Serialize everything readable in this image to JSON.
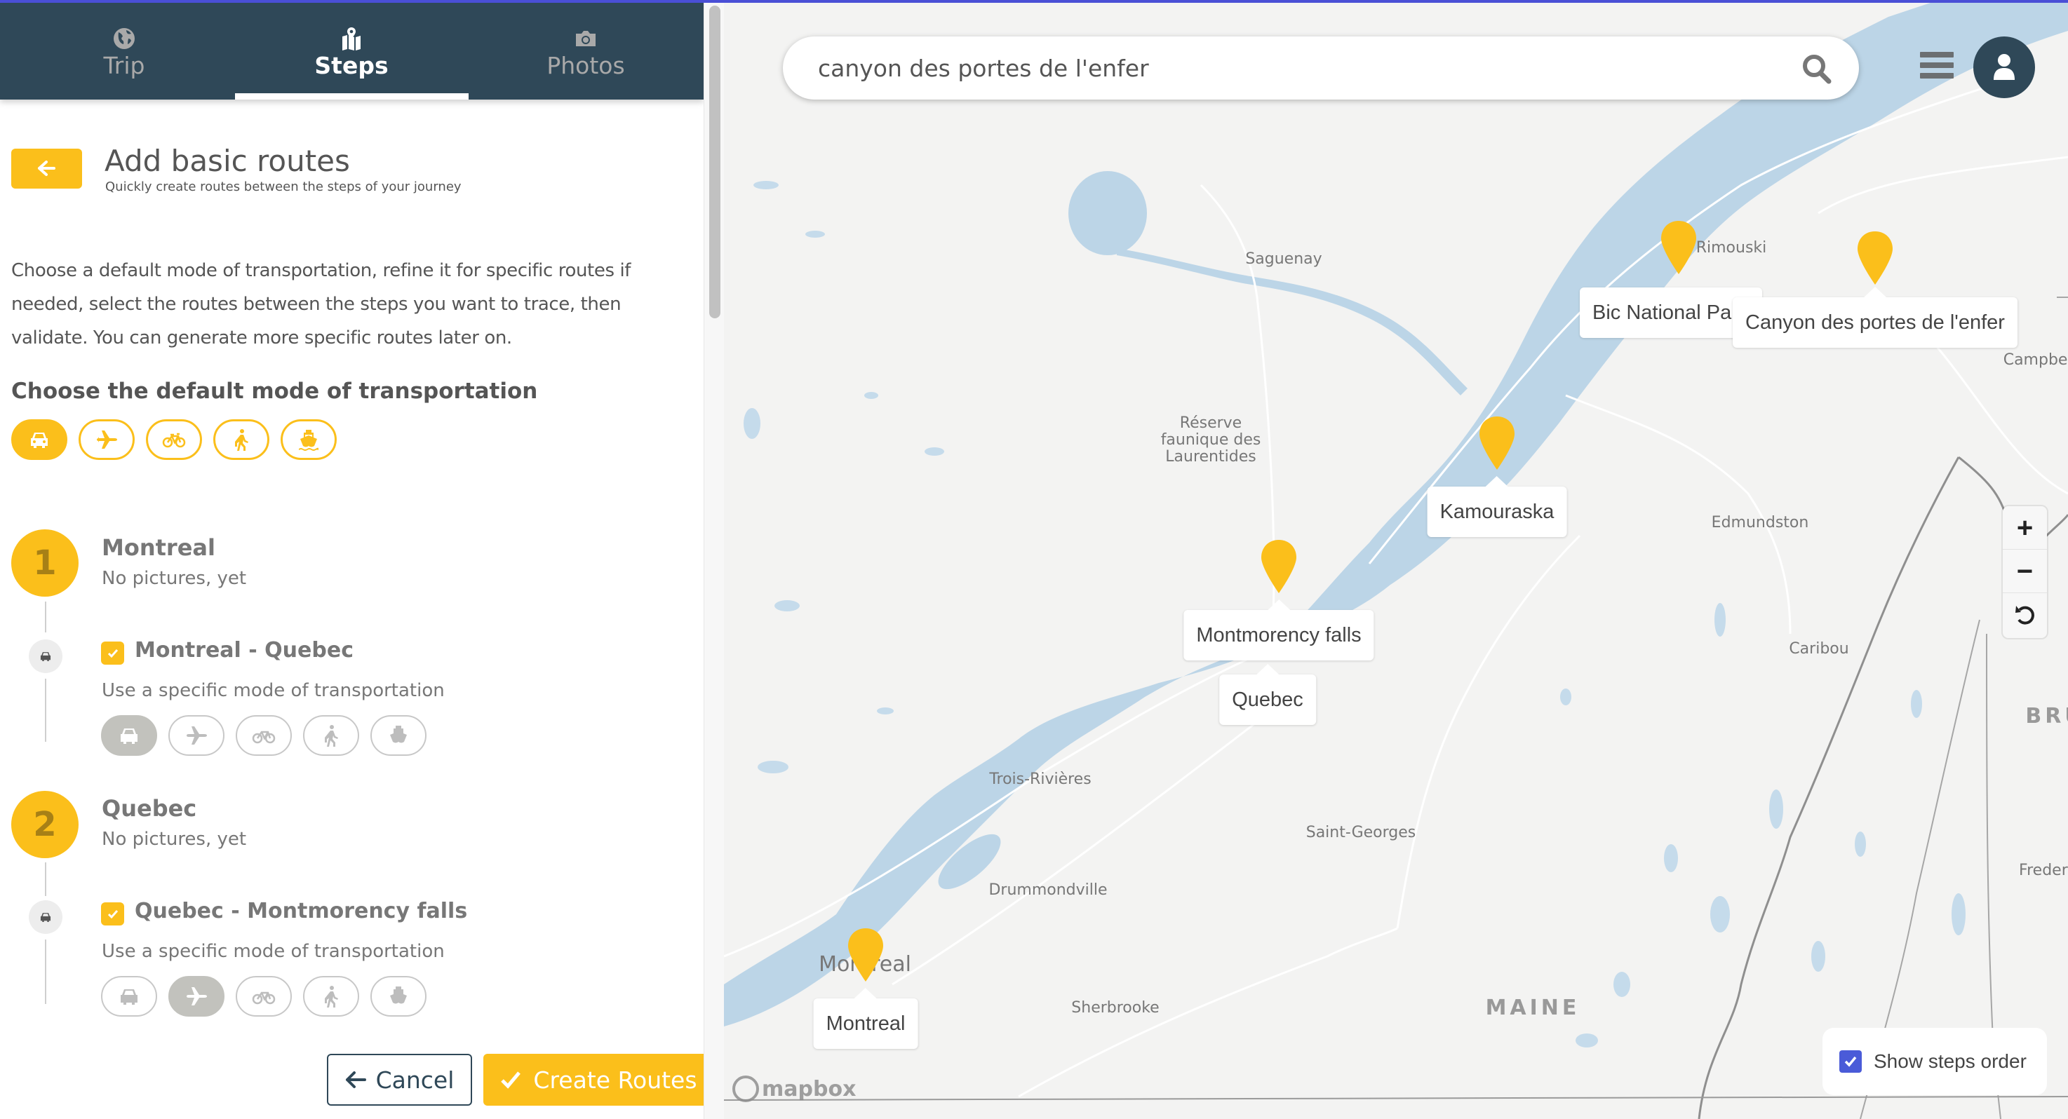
{
  "header": {
    "tabs": [
      {
        "label": "Trip",
        "icon": "globe-icon",
        "active": false
      },
      {
        "label": "Steps",
        "icon": "map-marker-icon",
        "active": true
      },
      {
        "label": "Photos",
        "icon": "camera-icon",
        "active": false
      }
    ]
  },
  "panel": {
    "back_icon": "arrow-left-icon",
    "title": "Add basic routes",
    "subtitle": "Quickly create routes between the steps of your journey",
    "intro": "Choose a default mode of transportation, refine it for specific routes if needed, select the routes between the steps you want to trace, then validate. You can generate more specific routes later on.",
    "default_mode_heading": "Choose the default mode of transportation",
    "modes": [
      "car",
      "plane",
      "bike",
      "walk",
      "boat"
    ],
    "default_mode_selected": "car",
    "steps": [
      {
        "number": "1",
        "name": "Montreal",
        "pictures": "No pictures, yet",
        "route": {
          "label": "Montreal - Quebec",
          "checked": true,
          "mode_icon": "car-icon",
          "specific_label": "Use a specific mode of transportation",
          "selected_mode": "car"
        }
      },
      {
        "number": "2",
        "name": "Quebec",
        "pictures": "No pictures, yet",
        "route": {
          "label": "Quebec - Montmorency falls",
          "checked": true,
          "mode_icon": "car-icon",
          "specific_label": "Use a specific mode of transportation",
          "selected_mode": "plane"
        }
      }
    ],
    "cancel_label": "Cancel",
    "create_label": "Create Routes"
  },
  "map": {
    "search_value": "canyon des portes de l'enfer",
    "search_icon": "search-icon",
    "menu_icon": "hamburger-icon",
    "avatar_icon": "user-icon",
    "zoom_in": "+",
    "zoom_out": "−",
    "reset_icon": "rotate-icon",
    "show_steps_order_label": "Show steps order",
    "show_steps_order_checked": true,
    "attribution": "mapbox",
    "place_labels": [
      {
        "name": "Saguenay"
      },
      {
        "name": "Rimouski"
      },
      {
        "name": "Réserve faunique des Laurentides"
      },
      {
        "name": "Edmundston"
      },
      {
        "name": "Caribou"
      },
      {
        "name": "Campbellt"
      },
      {
        "name": "BRU"
      },
      {
        "name": "Trois-Rivières"
      },
      {
        "name": "Saint-Georges"
      },
      {
        "name": "Drummondville"
      },
      {
        "name": "Frederic"
      },
      {
        "name": "Sherbrooke"
      },
      {
        "name": "MAINE"
      },
      {
        "name": "Montreal"
      }
    ],
    "markers": [
      {
        "name": "Montreal"
      },
      {
        "name": "Quebec"
      },
      {
        "name": "Montmorency falls"
      },
      {
        "name": "Kamouraska"
      },
      {
        "name": "Bic National Park",
        "visible_text": "Bic National Pa"
      },
      {
        "name": "Canyon des portes de l'enfer"
      }
    ]
  },
  "colors": {
    "accent": "#fbbf1b",
    "header": "#2f4858",
    "water": "#bcd5e7",
    "checkbox": "#4a5bd8"
  }
}
